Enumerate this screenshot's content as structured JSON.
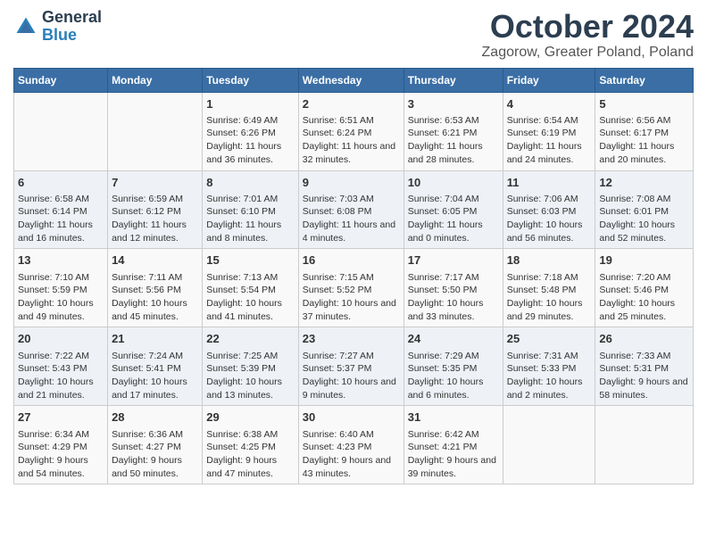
{
  "logo": {
    "general": "General",
    "blue": "Blue"
  },
  "title": "October 2024",
  "location": "Zagorow, Greater Poland, Poland",
  "days_of_week": [
    "Sunday",
    "Monday",
    "Tuesday",
    "Wednesday",
    "Thursday",
    "Friday",
    "Saturday"
  ],
  "weeks": [
    [
      {
        "day": "",
        "info": ""
      },
      {
        "day": "",
        "info": ""
      },
      {
        "day": "1",
        "info": "Sunrise: 6:49 AM\nSunset: 6:26 PM\nDaylight: 11 hours and 36 minutes."
      },
      {
        "day": "2",
        "info": "Sunrise: 6:51 AM\nSunset: 6:24 PM\nDaylight: 11 hours and 32 minutes."
      },
      {
        "day": "3",
        "info": "Sunrise: 6:53 AM\nSunset: 6:21 PM\nDaylight: 11 hours and 28 minutes."
      },
      {
        "day": "4",
        "info": "Sunrise: 6:54 AM\nSunset: 6:19 PM\nDaylight: 11 hours and 24 minutes."
      },
      {
        "day": "5",
        "info": "Sunrise: 6:56 AM\nSunset: 6:17 PM\nDaylight: 11 hours and 20 minutes."
      }
    ],
    [
      {
        "day": "6",
        "info": "Sunrise: 6:58 AM\nSunset: 6:14 PM\nDaylight: 11 hours and 16 minutes."
      },
      {
        "day": "7",
        "info": "Sunrise: 6:59 AM\nSunset: 6:12 PM\nDaylight: 11 hours and 12 minutes."
      },
      {
        "day": "8",
        "info": "Sunrise: 7:01 AM\nSunset: 6:10 PM\nDaylight: 11 hours and 8 minutes."
      },
      {
        "day": "9",
        "info": "Sunrise: 7:03 AM\nSunset: 6:08 PM\nDaylight: 11 hours and 4 minutes."
      },
      {
        "day": "10",
        "info": "Sunrise: 7:04 AM\nSunset: 6:05 PM\nDaylight: 11 hours and 0 minutes."
      },
      {
        "day": "11",
        "info": "Sunrise: 7:06 AM\nSunset: 6:03 PM\nDaylight: 10 hours and 56 minutes."
      },
      {
        "day": "12",
        "info": "Sunrise: 7:08 AM\nSunset: 6:01 PM\nDaylight: 10 hours and 52 minutes."
      }
    ],
    [
      {
        "day": "13",
        "info": "Sunrise: 7:10 AM\nSunset: 5:59 PM\nDaylight: 10 hours and 49 minutes."
      },
      {
        "day": "14",
        "info": "Sunrise: 7:11 AM\nSunset: 5:56 PM\nDaylight: 10 hours and 45 minutes."
      },
      {
        "day": "15",
        "info": "Sunrise: 7:13 AM\nSunset: 5:54 PM\nDaylight: 10 hours and 41 minutes."
      },
      {
        "day": "16",
        "info": "Sunrise: 7:15 AM\nSunset: 5:52 PM\nDaylight: 10 hours and 37 minutes."
      },
      {
        "day": "17",
        "info": "Sunrise: 7:17 AM\nSunset: 5:50 PM\nDaylight: 10 hours and 33 minutes."
      },
      {
        "day": "18",
        "info": "Sunrise: 7:18 AM\nSunset: 5:48 PM\nDaylight: 10 hours and 29 minutes."
      },
      {
        "day": "19",
        "info": "Sunrise: 7:20 AM\nSunset: 5:46 PM\nDaylight: 10 hours and 25 minutes."
      }
    ],
    [
      {
        "day": "20",
        "info": "Sunrise: 7:22 AM\nSunset: 5:43 PM\nDaylight: 10 hours and 21 minutes."
      },
      {
        "day": "21",
        "info": "Sunrise: 7:24 AM\nSunset: 5:41 PM\nDaylight: 10 hours and 17 minutes."
      },
      {
        "day": "22",
        "info": "Sunrise: 7:25 AM\nSunset: 5:39 PM\nDaylight: 10 hours and 13 minutes."
      },
      {
        "day": "23",
        "info": "Sunrise: 7:27 AM\nSunset: 5:37 PM\nDaylight: 10 hours and 9 minutes."
      },
      {
        "day": "24",
        "info": "Sunrise: 7:29 AM\nSunset: 5:35 PM\nDaylight: 10 hours and 6 minutes."
      },
      {
        "day": "25",
        "info": "Sunrise: 7:31 AM\nSunset: 5:33 PM\nDaylight: 10 hours and 2 minutes."
      },
      {
        "day": "26",
        "info": "Sunrise: 7:33 AM\nSunset: 5:31 PM\nDaylight: 9 hours and 58 minutes."
      }
    ],
    [
      {
        "day": "27",
        "info": "Sunrise: 6:34 AM\nSunset: 4:29 PM\nDaylight: 9 hours and 54 minutes."
      },
      {
        "day": "28",
        "info": "Sunrise: 6:36 AM\nSunset: 4:27 PM\nDaylight: 9 hours and 50 minutes."
      },
      {
        "day": "29",
        "info": "Sunrise: 6:38 AM\nSunset: 4:25 PM\nDaylight: 9 hours and 47 minutes."
      },
      {
        "day": "30",
        "info": "Sunrise: 6:40 AM\nSunset: 4:23 PM\nDaylight: 9 hours and 43 minutes."
      },
      {
        "day": "31",
        "info": "Sunrise: 6:42 AM\nSunset: 4:21 PM\nDaylight: 9 hours and 39 minutes."
      },
      {
        "day": "",
        "info": ""
      },
      {
        "day": "",
        "info": ""
      }
    ]
  ]
}
